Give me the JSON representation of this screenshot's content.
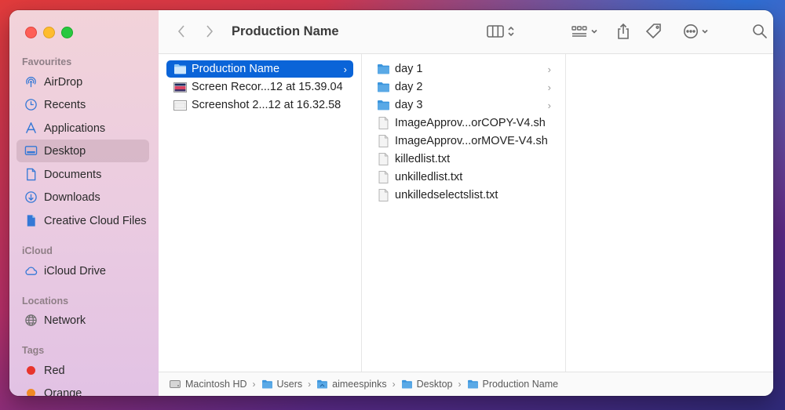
{
  "window": {
    "title": "Production Name"
  },
  "sidebar": {
    "sections": [
      {
        "label": "Favourites"
      },
      {
        "label": "iCloud"
      },
      {
        "label": "Locations"
      },
      {
        "label": "Tags"
      }
    ],
    "favourites": [
      {
        "label": "AirDrop",
        "icon": "airdrop-icon"
      },
      {
        "label": "Recents",
        "icon": "clock-icon"
      },
      {
        "label": "Applications",
        "icon": "applications-icon"
      },
      {
        "label": "Desktop",
        "icon": "desktop-icon",
        "selected": true
      },
      {
        "label": "Documents",
        "icon": "document-icon"
      },
      {
        "label": "Downloads",
        "icon": "download-icon"
      },
      {
        "label": "Creative Cloud Files",
        "icon": "file-icon"
      }
    ],
    "icloud": [
      {
        "label": "iCloud Drive",
        "icon": "cloud-icon"
      }
    ],
    "locations": [
      {
        "label": "Network",
        "icon": "globe-icon"
      }
    ],
    "tags": [
      {
        "label": "Red",
        "color": "#e8342c"
      },
      {
        "label": "Orange",
        "color": "#f08a24"
      }
    ]
  },
  "toolbar": {
    "back": "back",
    "forward": "forward"
  },
  "columns": {
    "col1": [
      {
        "name": "Production Name",
        "type": "folder",
        "selected": true,
        "has_children": true
      },
      {
        "name": "Screen Recor...12 at 15.39.04",
        "type": "video"
      },
      {
        "name": "Screenshot 2...12 at 16.32.58",
        "type": "image"
      }
    ],
    "col2": [
      {
        "name": "day 1",
        "type": "folder",
        "has_children": true
      },
      {
        "name": "day 2",
        "type": "folder",
        "has_children": true
      },
      {
        "name": "day 3",
        "type": "folder",
        "has_children": true
      },
      {
        "name": "ImageApprov...orCOPY-V4.sh",
        "type": "file"
      },
      {
        "name": "ImageApprov...orMOVE-V4.sh",
        "type": "file"
      },
      {
        "name": "killedlist.txt",
        "type": "file"
      },
      {
        "name": "unkilledlist.txt",
        "type": "file"
      },
      {
        "name": "unkilledselectslist.txt",
        "type": "file"
      }
    ]
  },
  "pathbar": [
    {
      "label": "Macintosh HD",
      "icon": "disk-icon"
    },
    {
      "label": "Users",
      "icon": "folder-icon"
    },
    {
      "label": "aimeespinks",
      "icon": "home-folder-icon"
    },
    {
      "label": "Desktop",
      "icon": "folder-icon"
    },
    {
      "label": "Production Name",
      "icon": "folder-icon"
    }
  ],
  "colors": {
    "selection": "#0a64d8",
    "folder": "#5aa9e6",
    "close": "#fe5f57",
    "minimize": "#febc2e",
    "maximize": "#28c840"
  }
}
